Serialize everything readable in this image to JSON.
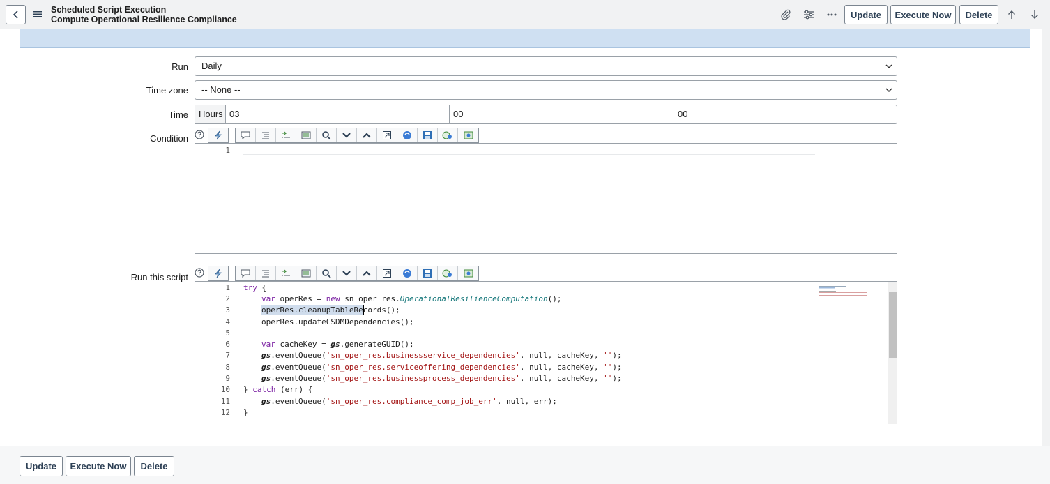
{
  "header": {
    "record_type": "Scheduled Script Execution",
    "record_name": "Compute Operational Resilience Compliance",
    "buttons": {
      "update": "Update",
      "execute_now": "Execute Now",
      "delete": "Delete"
    }
  },
  "form": {
    "run": {
      "label": "Run",
      "value": "Daily"
    },
    "time_zone": {
      "label": "Time zone",
      "value": "-- None --"
    },
    "time": {
      "label": "Time",
      "prefix": "Hours",
      "hours": "03",
      "minutes": "00",
      "seconds": "00"
    },
    "condition": {
      "label": "Condition",
      "line_numbers": [
        "1"
      ]
    },
    "script": {
      "label": "Run this script",
      "line_numbers": [
        "1",
        "2",
        "3",
        "4",
        "5",
        "6",
        "7",
        "8",
        "9",
        "10",
        "11",
        "12"
      ]
    }
  },
  "code": {
    "l1_try": "try",
    "l1_brace": " {",
    "l2_var": "var",
    "l2_mid": " operRes = ",
    "l2_new": "new",
    "l2_ns": " sn_oper_res.",
    "l2_cls": "OperationalResilienceComputation",
    "l2_end": "();",
    "l3_sel": "operRes.cleanupTableRe",
    "l3_rest": "cords();",
    "l4": "operRes.updateCSDMDependencies();",
    "l6_var": "var",
    "l6_mid": " cacheKey = ",
    "l6_gs": "gs",
    "l6_end": ".generateGUID();",
    "eq_gs": "gs",
    "eq_fn": ".eventQueue(",
    "l7_str": "'sn_oper_res.businessservice_dependencies'",
    "l8_str": "'sn_oper_res.serviceoffering_dependencies'",
    "l9_str": "'sn_oper_res.businessprocess_dependencies'",
    "eq_args": ", null, cacheKey, ",
    "eq_empty": "''",
    "eq_close": ");",
    "l10_a": "} ",
    "l10_catch": "catch",
    "l10_b": " (err) {",
    "l11_str": "'sn_oper_res.compliance_comp_job_err'",
    "l11_args": ", null, err);",
    "l12": "}"
  },
  "footer": {
    "update": "Update",
    "execute_now": "Execute Now",
    "delete": "Delete"
  },
  "colors": {
    "banner": "#cfe0f2",
    "header_bg": "#f1f2f3",
    "button_text": "#2e4156",
    "keyword": "#7a1fa2",
    "string": "#a31515",
    "class": "#1b7a7d"
  }
}
